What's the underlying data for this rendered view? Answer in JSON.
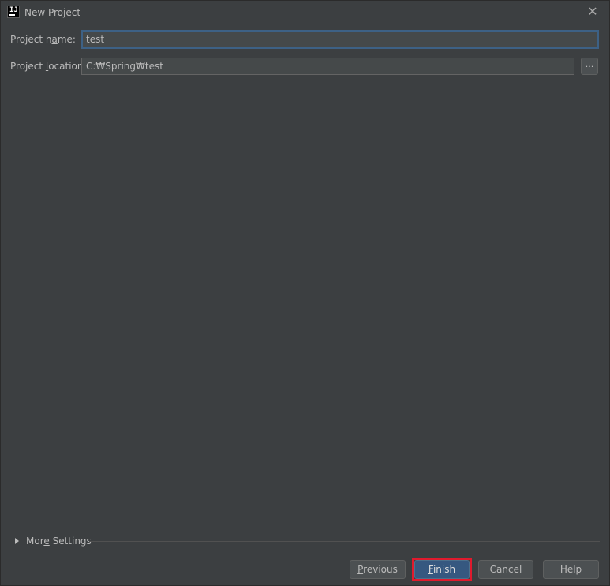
{
  "window": {
    "title": "New Project",
    "icon": "intellij-idea-icon",
    "close_icon": "close-icon"
  },
  "form": {
    "project_name": {
      "label_pre": "Project n",
      "label_mnemonic": "a",
      "label_post": "me:",
      "value": "test"
    },
    "project_location": {
      "label_pre": "Project ",
      "label_mnemonic": "l",
      "label_post": "ocation:",
      "value": "C:₩Spring₩test",
      "browse_label": "..."
    }
  },
  "more_settings": {
    "label_pre": "Mor",
    "label_mnemonic": "e",
    "label_post": " Settings",
    "expanded": false
  },
  "buttons": {
    "previous": {
      "mnemonic": "P",
      "rest": "revious"
    },
    "finish": {
      "mnemonic": "F",
      "rest": "inish"
    },
    "cancel": {
      "label": "Cancel"
    },
    "help": {
      "label": "Help"
    }
  },
  "colors": {
    "background": "#3c3f41",
    "primary_button": "#365880",
    "focus_border": "#3d6185",
    "highlight": "#e01a2d"
  }
}
